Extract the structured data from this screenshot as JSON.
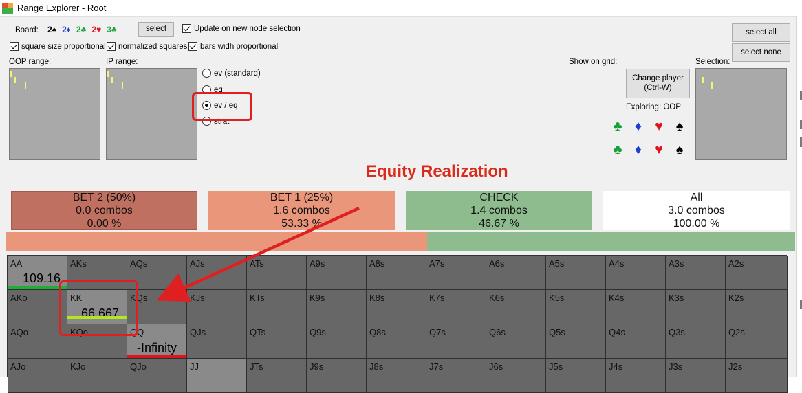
{
  "window": {
    "title": "Range Explorer  - Root",
    "icon": "app-icon"
  },
  "board": {
    "label": "Board:",
    "cards": [
      {
        "text": "2♠",
        "color": "#000000"
      },
      {
        "text": "2♦",
        "color": "#1f3fd0"
      },
      {
        "text": "2♣",
        "color": "#16a03c"
      },
      {
        "text": "2♥",
        "color": "#e0141e"
      },
      {
        "text": "3♣",
        "color": "#16a03c"
      }
    ],
    "select_label": "select"
  },
  "options": {
    "update_on_node": "Update on new node selection",
    "square_size": "square size proportional",
    "normalized": "normalized squares",
    "bars_width": "bars widh proportional"
  },
  "buttons": {
    "select_all": "select all",
    "select_none": "select none",
    "change_player": "Change player\n(Ctrl-W)"
  },
  "ranges": {
    "oop_label": "OOP range:",
    "ip_label": "IP range:",
    "selection_label": "Selection:"
  },
  "show_on_grid": {
    "label": "Show on grid:",
    "options": [
      {
        "label": "ev (standard)",
        "selected": false
      },
      {
        "label": "eq",
        "selected": false
      },
      {
        "label": "ev / eq",
        "selected": true
      },
      {
        "label": "strat",
        "selected": false
      }
    ]
  },
  "exploring": "Exploring: OOP",
  "suits": [
    {
      "icon": "club-icon",
      "glyph": "♣",
      "color": "#16a03c"
    },
    {
      "icon": "diamond-icon",
      "glyph": "♦",
      "color": "#1f3fd0"
    },
    {
      "icon": "heart-icon",
      "glyph": "♥",
      "color": "#e0141e"
    },
    {
      "icon": "spade-icon",
      "glyph": "♠",
      "color": "#000000"
    }
  ],
  "annotation": {
    "heading": "Equity Realization",
    "highlight_color": "#e02020"
  },
  "actions": [
    {
      "name": "BET 2 (50%)",
      "combos": "0.0 combos",
      "pct": "0.00 %",
      "color": "#c07060"
    },
    {
      "name": "BET 1 (25%)",
      "combos": "1.6 combos",
      "pct": "53.33 %",
      "color": "#ea967b"
    },
    {
      "name": "CHECK",
      "combos": "1.4 combos",
      "pct": "46.67 %",
      "color": "#8fbc8f"
    },
    {
      "name": "All",
      "combos": "3.0 combos",
      "pct": "100.00 %",
      "color": "#ffffff"
    }
  ],
  "strategy_bar": {
    "segments": [
      {
        "label": "BET 1 (25%)",
        "fraction": 0.5333,
        "color": "#ea967b"
      },
      {
        "label": "CHECK",
        "fraction": 0.4667,
        "color": "#8fbc8f"
      }
    ]
  },
  "grid": {
    "rows": [
      [
        "AA",
        "AKs",
        "AQs",
        "AJs",
        "ATs",
        "A9s",
        "A8s",
        "A7s",
        "A6s",
        "A5s",
        "A4s",
        "A3s",
        "A2s"
      ],
      [
        "AKo",
        "KK",
        "KQs",
        "KJs",
        "KTs",
        "K9s",
        "K8s",
        "K7s",
        "K6s",
        "K5s",
        "K4s",
        "K3s",
        "K2s"
      ],
      [
        "AQo",
        "KQo",
        "QQ",
        "QJs",
        "QTs",
        "Q9s",
        "Q8s",
        "Q7s",
        "Q6s",
        "Q5s",
        "Q4s",
        "Q3s",
        "Q2s"
      ],
      [
        "AJo",
        "KJo",
        "QJo",
        "JJ",
        "JTs",
        "J9s",
        "J8s",
        "J7s",
        "J6s",
        "J5s",
        "J4s",
        "J3s",
        "J2s"
      ]
    ],
    "values": [
      {
        "row": 0,
        "col": 0,
        "value": "109.16",
        "bar_color": "#1fae3c"
      },
      {
        "row": 1,
        "col": 1,
        "value": "66.667",
        "bar_color": "#b5e61d"
      },
      {
        "row": 2,
        "col": 2,
        "value": "-Infinity",
        "bar_color": "#e0141e"
      }
    ],
    "highlighted": [
      "AA",
      "KK",
      "QQ",
      "JJ"
    ],
    "cell_color": "#676767",
    "highlight_color": "#8a8a8a"
  }
}
